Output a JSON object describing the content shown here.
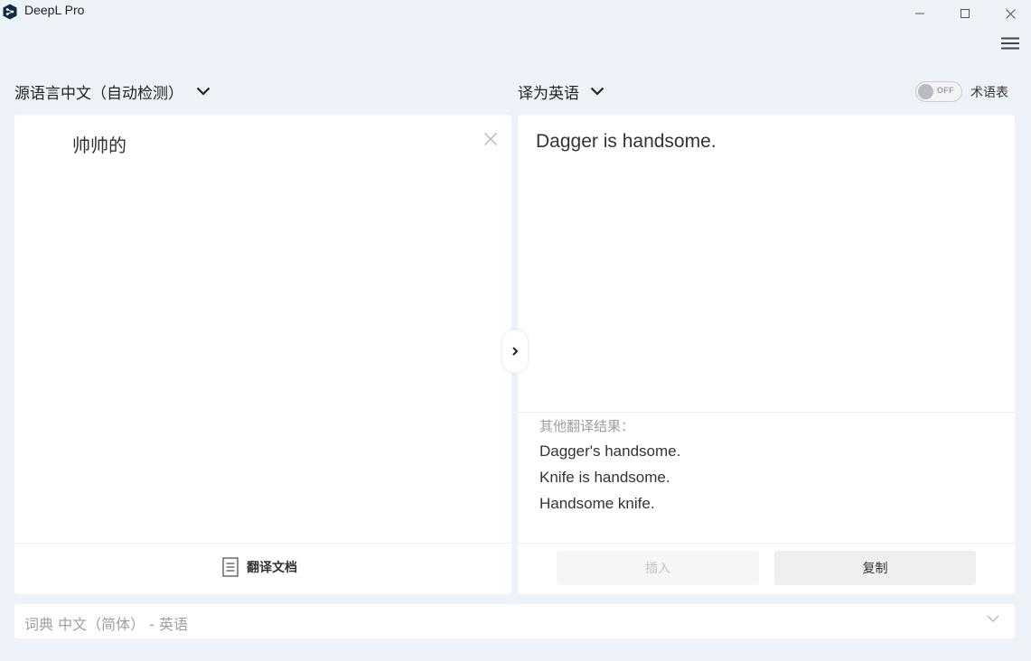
{
  "app": {
    "title": "DeepL Pro"
  },
  "source": {
    "language_label": "源语言中文（自动检测）",
    "text": "帅帅的",
    "translate_document_label": "翻译文档"
  },
  "target": {
    "language_label": "译为英语",
    "text": "Dagger is handsome.",
    "glossary": {
      "toggle_label": "OFF",
      "label": "术语表"
    },
    "alternatives": {
      "title": "其他翻译结果：",
      "items": [
        "Dagger's handsome.",
        "Knife is handsome.",
        "Handsome knife."
      ]
    },
    "insert_label": "插入",
    "copy_label": "复制"
  },
  "dictionary": {
    "label": "词典 中文（简体） - 英语"
  },
  "colors": {
    "background": "#eef3fa",
    "panel": "#ffffff",
    "text": "#333333",
    "muted": "#9aa0a6"
  }
}
